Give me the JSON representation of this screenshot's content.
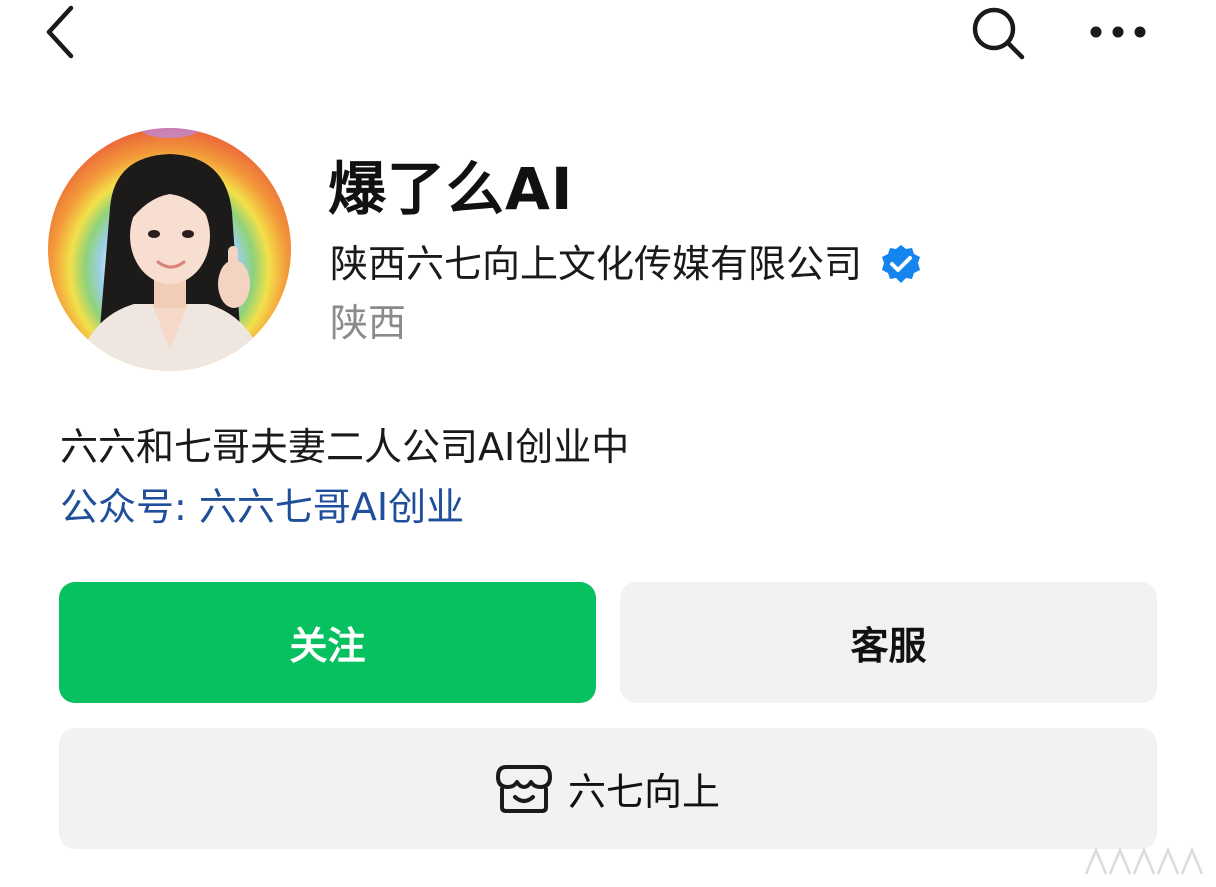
{
  "topbar": {
    "back_icon": "chevron-left-icon",
    "search_icon": "search-icon",
    "more_icon": "more-horizontal-icon"
  },
  "profile": {
    "name": "爆了么AI",
    "company": "陕西六七向上文化传媒有限公司",
    "verified_icon": "verified-badge-icon",
    "verified_color": "#1485ee",
    "region": "陕西"
  },
  "bio": {
    "text": "六六和七哥夫妻二人公司AI创业中",
    "official_account": "公众号: 六六七哥AI创业",
    "link_color": "#1f4f9a"
  },
  "actions": {
    "follow_label": "关注",
    "follow_color": "#07c160",
    "service_label": "客服",
    "shop_label": "六七向上",
    "shop_icon": "shop-store-icon"
  }
}
